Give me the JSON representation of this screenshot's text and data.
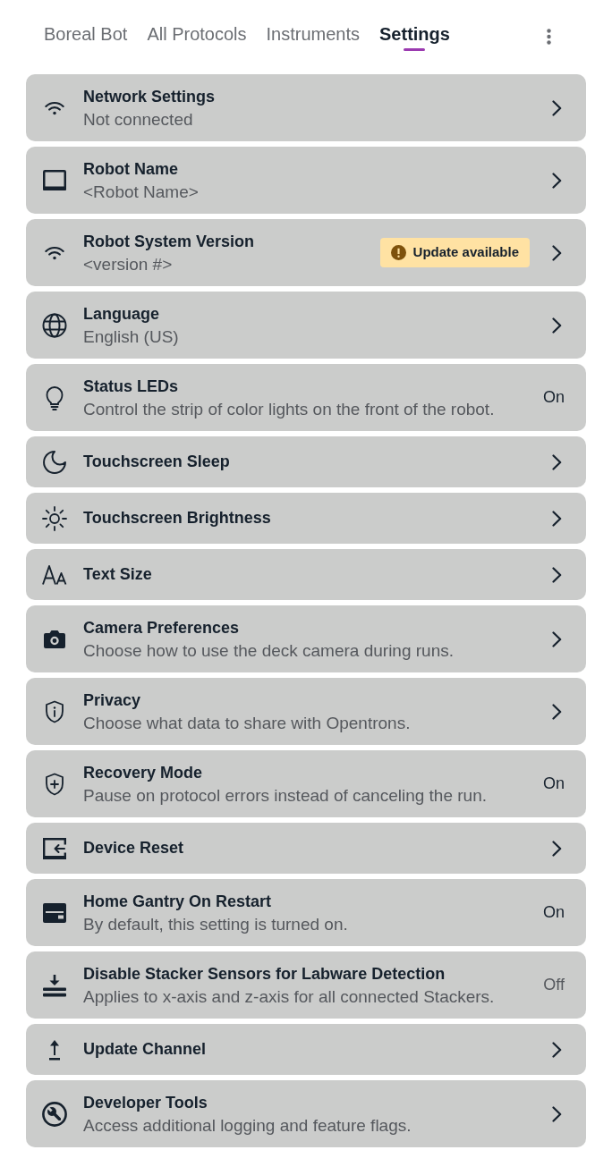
{
  "tabs": [
    {
      "label": "Boreal Bot",
      "selected": false
    },
    {
      "label": "All Protocols",
      "selected": false
    },
    {
      "label": "Instruments",
      "selected": false
    },
    {
      "label": "Settings",
      "selected": true
    }
  ],
  "settings": [
    {
      "kind": "link",
      "title": "Network Settings",
      "subtitle": "Not connected"
    },
    {
      "kind": "link",
      "title": "Robot Name",
      "subtitle": "<Robot Name>"
    },
    {
      "kind": "link",
      "title": "Robot System Version",
      "subtitle": "<version #>",
      "badge": "Update available"
    },
    {
      "kind": "link",
      "title": "Language",
      "subtitle": "English (US)"
    },
    {
      "kind": "toggle",
      "title": "Status LEDs",
      "subtitle": "Control the strip of color lights on the front of the robot.",
      "on": true,
      "value": "On"
    },
    {
      "kind": "link",
      "title": "Touchscreen Sleep"
    },
    {
      "kind": "link",
      "title": "Touchscreen Brightness"
    },
    {
      "kind": "link",
      "title": "Text Size"
    },
    {
      "kind": "link",
      "title": "Camera Preferences",
      "subtitle": "Choose how to use the deck camera during runs."
    },
    {
      "kind": "link",
      "title": "Privacy",
      "subtitle": "Choose what data to share with Opentrons."
    },
    {
      "kind": "toggle",
      "title": "Recovery Mode",
      "subtitle": "Pause on protocol errors instead of canceling the run.",
      "on": true,
      "value": "On"
    },
    {
      "kind": "link",
      "title": "Device Reset"
    },
    {
      "kind": "toggle",
      "title": "Home Gantry On Restart",
      "subtitle": "By default, this setting is turned on.",
      "on": true,
      "value": "On"
    },
    {
      "kind": "toggle",
      "title": "Disable Stacker Sensors for Labware Detection",
      "subtitle": "Applies to x-axis and z-axis for all connected Stackers.",
      "on": false,
      "value": "Off"
    },
    {
      "kind": "link",
      "title": "Update Channel"
    },
    {
      "kind": "link",
      "title": "Developer Tools",
      "subtitle": "Access additional logging and feature flags."
    }
  ]
}
